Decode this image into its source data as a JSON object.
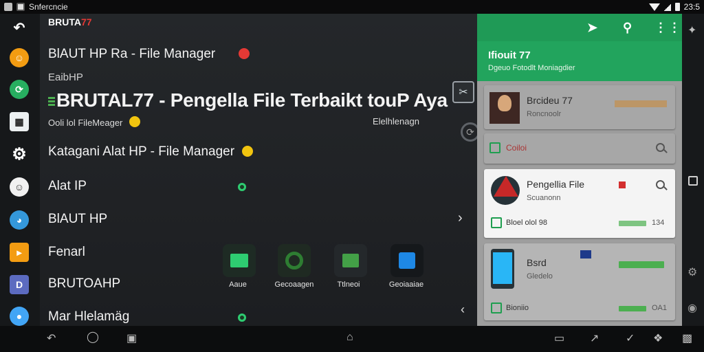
{
  "status_bar": {
    "title": "Snfercncie",
    "time": "23:5"
  },
  "main": {
    "brand_prefix": "BRUTA",
    "brand_suffix": "77",
    "rows": [
      {
        "label": "BlAUT HP Ra - File Manager"
      },
      {
        "label": "EaibHP"
      },
      {
        "label": "Katagani Alat HP - File Manager"
      },
      {
        "label": "Alat IP"
      },
      {
        "label": "BlAUT HP"
      },
      {
        "label": "Fenarl"
      },
      {
        "label": "BRUTOAHP"
      },
      {
        "label": "Mar Hlelamäg"
      }
    ],
    "headline": "BRUTAL77 - Pengella File Terbaikt touP Aya",
    "sub_left": "Ooli lol FileMeager",
    "sub_right": "Elelhlenagn",
    "apps": [
      {
        "label": "Aaue",
        "icon": "photo-icon",
        "color": "#2ecc71"
      },
      {
        "label": "Gecoaagen",
        "icon": "refresh-icon",
        "color": "#2e7d32"
      },
      {
        "label": "Ttlneoi",
        "icon": "media-icon",
        "color": "#43a047"
      },
      {
        "label": "Geoiaaiae",
        "icon": "edge-icon",
        "color": "#1e88e5"
      }
    ]
  },
  "right_panel": {
    "title": "Ifiouit 77",
    "subtitle": "Dgeuo Fotodlt Moniagdier",
    "cards": [
      {
        "title": "Brcideu 77",
        "sub": "Roncnoolr"
      },
      {
        "title": "Coiloi",
        "sub": ""
      },
      {
        "title": "Pengellia File",
        "sub": "Scuanonn",
        "footer": "Bloel olol 98",
        "value": "134"
      },
      {
        "title": "Bsrd",
        "sub": "Gledelo",
        "footer": "Bioniio",
        "value": "OA1"
      }
    ]
  }
}
